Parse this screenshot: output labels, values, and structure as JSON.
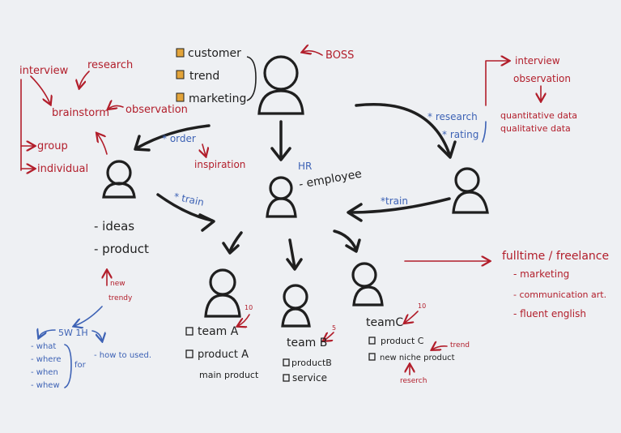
{
  "top": {
    "list": [
      "customer",
      "trend",
      "marketing"
    ],
    "boss": "BOSS",
    "hr": "HR",
    "employee": "- employee"
  },
  "left": {
    "interview": "interview",
    "research": "research",
    "brainstorm": "brainstorm",
    "observation": "observation",
    "group": "group",
    "individual": "individual",
    "order": "* order",
    "inspiration": "inspiration",
    "train": "* train",
    "ideas": "- ideas",
    "product": "- product",
    "new_trendy": [
      "new",
      "trendy"
    ],
    "five_w": "5W 1H",
    "wh_list": [
      "- what",
      "- where",
      "- when",
      "- whew"
    ],
    "for": "for",
    "how_to": "- how to used."
  },
  "right": {
    "research": "* research",
    "rating": "* rating",
    "interview": "interview",
    "observation": "observation",
    "quant": "quantitative data",
    "qual": "qualitative data",
    "train": "*train",
    "fulltime": "fulltime / freelance",
    "skills": [
      "- marketing",
      "- communication art.",
      "- fluent english"
    ]
  },
  "teams": {
    "a": {
      "name": "team A",
      "count": "10",
      "items": [
        "product A",
        "main product"
      ]
    },
    "b": {
      "name": "team B",
      "count": "5",
      "items": [
        "productB",
        "service"
      ]
    },
    "c": {
      "name": "teamC",
      "count": "10",
      "items": [
        "product C",
        "new niche product"
      ],
      "trend": "trend",
      "research": "reserch"
    }
  },
  "colors": {
    "ink": "#1f1f1f",
    "red": "#b21e2b",
    "blue": "#3d62b5",
    "marker": "#e3a43a"
  }
}
